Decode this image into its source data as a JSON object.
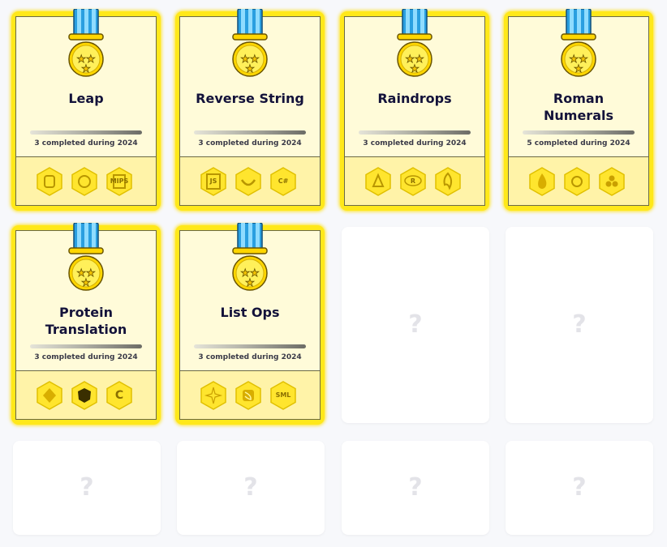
{
  "exercises": [
    {
      "title": "Leap",
      "completed_text": "3 completed during 2024",
      "tracks": [
        {
          "icon": "python-icon",
          "label": ""
        },
        {
          "icon": "crystal-icon",
          "label": ""
        },
        {
          "icon": "mips-icon",
          "label": "MIPS"
        }
      ]
    },
    {
      "title": "Reverse String",
      "completed_text": "3 completed during 2024",
      "tracks": [
        {
          "icon": "javascript-icon",
          "label": "JS"
        },
        {
          "icon": "gleam-icon",
          "label": ""
        },
        {
          "icon": "csharp-icon",
          "label": "C#"
        }
      ]
    },
    {
      "title": "Raindrops",
      "completed_text": "3 completed during 2024",
      "tracks": [
        {
          "icon": "groovy-icon",
          "label": ""
        },
        {
          "icon": "r-icon",
          "label": "R"
        },
        {
          "icon": "zig-icon",
          "label": ""
        }
      ]
    },
    {
      "title": "Roman Numerals",
      "completed_text": "5 completed during 2024",
      "tracks": [
        {
          "icon": "elixir-icon",
          "label": ""
        },
        {
          "icon": "pharo-icon",
          "label": ""
        },
        {
          "icon": "ballerina-icon",
          "label": ""
        }
      ]
    },
    {
      "title": "Protein Translation",
      "completed_text": "3 completed during 2024",
      "tracks": [
        {
          "icon": "kotlin-icon",
          "label": ""
        },
        {
          "icon": "clojure-icon",
          "label": ""
        },
        {
          "icon": "c-icon",
          "label": "C"
        }
      ]
    },
    {
      "title": "List Ops",
      "completed_text": "3 completed during 2024",
      "tracks": [
        {
          "icon": "elm-icon",
          "label": ""
        },
        {
          "icon": "swift-icon",
          "label": ""
        },
        {
          "icon": "sml-icon",
          "label": "SML"
        }
      ]
    }
  ],
  "locked_label": "?",
  "colors": {
    "card": "#ffe81a",
    "card_inner": "#fffbd9",
    "tracks_bg": "#fff3a8",
    "ribbon": "#55c8f0",
    "medal": "#ffd600",
    "locked_mark": "#e3e3e8"
  }
}
